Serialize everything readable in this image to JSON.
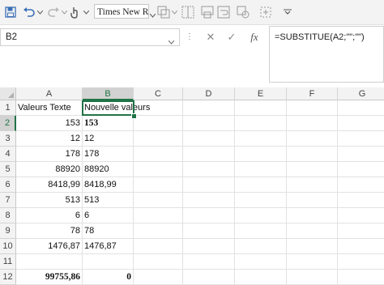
{
  "toolbar": {
    "font_name": "Times New R",
    "icons": [
      "save-icon",
      "undo-icon",
      "redo-icon",
      "touch-mode-icon",
      "format-painter-icon",
      "borders-icon",
      "merge-icon",
      "wrap-icon",
      "conditional-format-icon",
      "sort-icon",
      "chevron-down-icon"
    ]
  },
  "formula_bar": {
    "name_box": "B2",
    "cancel": "✕",
    "enter": "✓",
    "fx": "fx",
    "formula": "=SUBSTITUE(A2;\"\";\"\")"
  },
  "columns": [
    "A",
    "B",
    "C",
    "D",
    "E",
    "F",
    "G"
  ],
  "rows": [
    "1",
    "2",
    "3",
    "4",
    "5",
    "6",
    "7",
    "8",
    "9",
    "10",
    "11",
    "12"
  ],
  "cells": {
    "A1": "Valeurs  Texte",
    "B1": "Nouvelle valeurs",
    "A2": "153",
    "B2": "153",
    "A3": "12",
    "B3": "12",
    "A4": "178",
    "B4": "178",
    "A5": "88920",
    "B5": "88920",
    "A6": "8418,99",
    "B6": "8418,99",
    "A7": "513",
    "B7": "513",
    "A8": "6",
    "B8": "6",
    "A9": "78",
    "B9": "78",
    "A10": "1476,87",
    "B10": "1476,87",
    "A12": "99755,86",
    "B12": "0"
  },
  "selection": {
    "cell": "B2",
    "accent": "#217346"
  }
}
